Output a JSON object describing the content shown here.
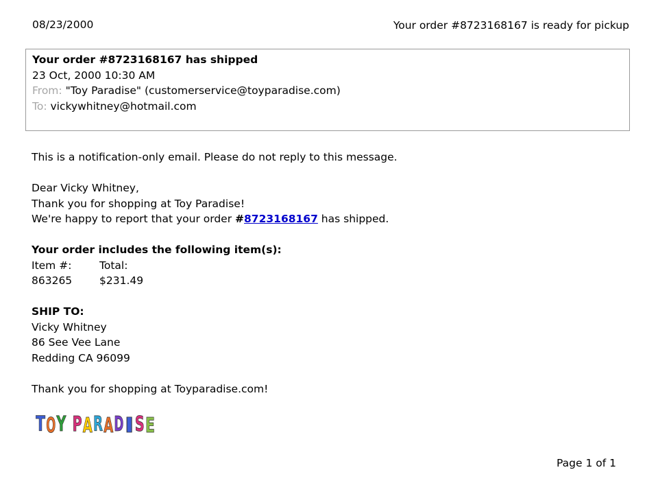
{
  "page": {
    "date": "08/23/2000",
    "subject_line": "Your order #8723168167 is ready for pickup",
    "page_number": "Page 1 of 1"
  },
  "email_header": {
    "subject": "Your order #8723168167 has shipped",
    "datetime": "23 Oct, 2000 10:30 AM",
    "from_label": "From:",
    "from_value": "\"Toy Paradise\" (customerservice@toyparadise.com)",
    "to_label": "To:",
    "to_value": "vickywhitney@hotmail.com"
  },
  "email_body": {
    "notice": "This is a notification-only email. Please do not reply to this message.",
    "greeting": "Dear Vicky Whitney,",
    "thanks": "Thank you for shopping at Toy Paradise!",
    "shipped_prefix": "We're happy to report that your order ",
    "order_hash": "#",
    "order_number": "8723168167",
    "shipped_suffix": " has shipped.",
    "items_heading": "Your order includes the following item(s):",
    "item_col_header": "Item #:",
    "total_col_header": "Total:",
    "items": [
      {
        "item": "863265",
        "total": "$231.49"
      }
    ],
    "ship_to_heading": "SHIP TO:",
    "ship_name": "Vicky Whitney",
    "ship_street": "86 See Vee Lane",
    "ship_city": "Redding CA 96099",
    "closing": "Thank you for shopping at Toyparadise.com!"
  },
  "logo": {
    "text": "TOY PARADISE",
    "letter_colors": [
      "#3d5fd6",
      "#e8702a",
      "#2f9e3a",
      "#ffffff",
      "#d8317c",
      "#ffcc00",
      "#2ea6d8",
      "#e8702a",
      "#7a3fc9",
      "#3d5fd6",
      "#d8317c",
      "#8bc34a"
    ]
  }
}
